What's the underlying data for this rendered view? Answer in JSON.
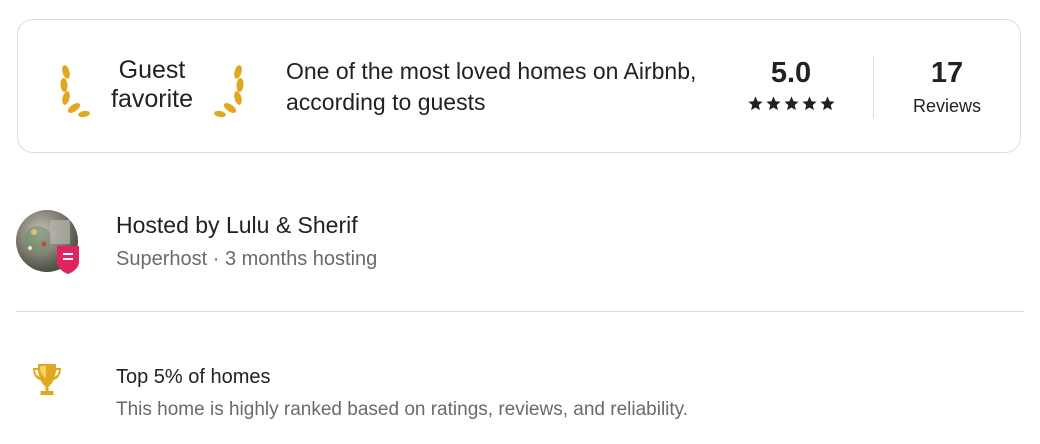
{
  "guest_favorite": {
    "badge_line1": "Guest",
    "badge_line2": "favorite",
    "description": "One of the most loved homes on Airbnb, according to guests",
    "rating": "5.0",
    "stars": 5,
    "reviews_count": "17",
    "reviews_label": "Reviews",
    "icons": [
      "laurel-left-icon",
      "laurel-right-icon",
      "star-icon"
    ],
    "colors": {
      "laurel": "#e0a81f",
      "border": "#dddddd",
      "star": "#222222"
    }
  },
  "host": {
    "name": "Hosted by Lulu & Sherif",
    "subtitle": "Superhost · 3 months hosting",
    "badge_icon": "superhost-badge-icon",
    "colors": {
      "badge": "#e0245e"
    }
  },
  "highlight": {
    "icon": "trophy-icon",
    "title": "Top 5% of homes",
    "description": "This home is highly ranked based on ratings, reviews, and reliability."
  }
}
